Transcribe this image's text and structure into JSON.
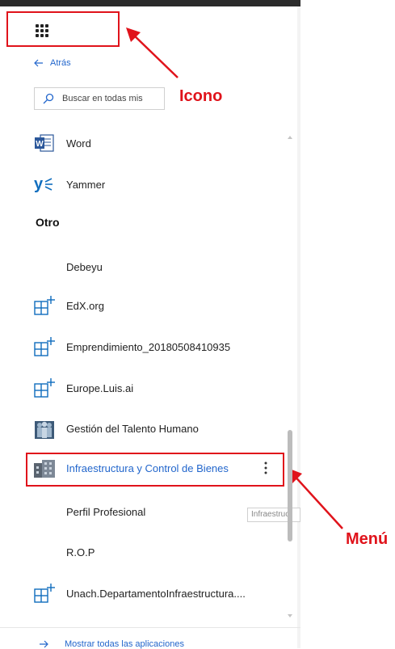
{
  "annotations": {
    "icon_label": "Icono",
    "menu_label": "Menú"
  },
  "nav": {
    "back_label": "Atrás"
  },
  "search": {
    "placeholder": "Buscar en todas mis"
  },
  "apps": [
    {
      "label": "Word",
      "icon": "word-icon"
    },
    {
      "label": "Yammer",
      "icon": "yammer-icon"
    }
  ],
  "section": {
    "title": "Otro"
  },
  "other_apps": [
    {
      "label": "Debeyu",
      "icon": "none"
    },
    {
      "label": "EdX.org",
      "icon": "app-add-icon"
    },
    {
      "label": "Emprendimiento_20180508410935",
      "icon": "app-add-icon"
    },
    {
      "label": "Europe.Luis.ai",
      "icon": "app-add-icon"
    },
    {
      "label": "Gestión del Talento Humano",
      "icon": "people-icon"
    },
    {
      "label": "Infraestructura y Control de Bienes",
      "icon": "building-icon"
    },
    {
      "label": "Perfil Profesional",
      "icon": "none"
    },
    {
      "label": "R.O.P",
      "icon": "none"
    },
    {
      "label": "Unach.DepartamentoInfraestructura....",
      "icon": "app-add-icon"
    }
  ],
  "tooltip": {
    "text": "Infraestruc"
  },
  "footer": {
    "label": "Mostrar todas las aplicaciones"
  },
  "colors": {
    "accent": "#2266cc",
    "annotation": "#e0131b",
    "word_blue": "#2b579a",
    "yammer_blue": "#106ebe",
    "grid_icon_blue": "#0f6cbd"
  }
}
